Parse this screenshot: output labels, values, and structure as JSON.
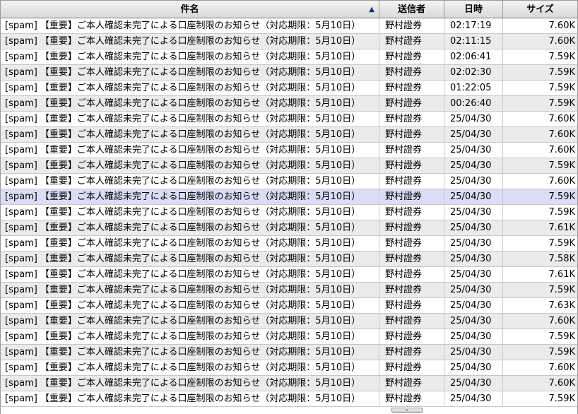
{
  "columns": {
    "subject": "件名",
    "sender": "送信者",
    "date": "日時",
    "size": "サイズ"
  },
  "sort": {
    "column": "subject",
    "direction": "ascending",
    "icon": "sort-up-triangle-icon"
  },
  "selected_row_index": 11,
  "rows": [
    {
      "subject": "[spam] 【重要】ご本人確認未完了による口座制限のお知らせ（対応期限：5月10日）",
      "sender": "野村證券",
      "date": "02:17:19",
      "size": "7.60K"
    },
    {
      "subject": "[spam] 【重要】ご本人確認未完了による口座制限のお知らせ（対応期限：5月10日）",
      "sender": "野村證券",
      "date": "02:11:15",
      "size": "7.60K"
    },
    {
      "subject": "[spam] 【重要】ご本人確認未完了による口座制限のお知らせ（対応期限：5月10日）",
      "sender": "野村證券",
      "date": "02:06:41",
      "size": "7.59K"
    },
    {
      "subject": "[spam] 【重要】ご本人確認未完了による口座制限のお知らせ（対応期限：5月10日）",
      "sender": "野村證券",
      "date": "02:02:30",
      "size": "7.59K"
    },
    {
      "subject": "[spam] 【重要】ご本人確認未完了による口座制限のお知らせ（対応期限：5月10日）",
      "sender": "野村證券",
      "date": "01:22:05",
      "size": "7.59K"
    },
    {
      "subject": "[spam] 【重要】ご本人確認未完了による口座制限のお知らせ（対応期限：5月10日）",
      "sender": "野村證券",
      "date": "00:26:40",
      "size": "7.59K"
    },
    {
      "subject": "[spam] 【重要】ご本人確認未完了による口座制限のお知らせ（対応期限：5月10日）",
      "sender": "野村證券",
      "date": "25/04/30",
      "size": "7.60K"
    },
    {
      "subject": "[spam] 【重要】ご本人確認未完了による口座制限のお知らせ（対応期限：5月10日）",
      "sender": "野村證券",
      "date": "25/04/30",
      "size": "7.60K"
    },
    {
      "subject": "[spam] 【重要】ご本人確認未完了による口座制限のお知らせ（対応期限：5月10日）",
      "sender": "野村證券",
      "date": "25/04/30",
      "size": "7.60K"
    },
    {
      "subject": "[spam] 【重要】ご本人確認未完了による口座制限のお知らせ（対応期限：5月10日）",
      "sender": "野村證券",
      "date": "25/04/30",
      "size": "7.59K"
    },
    {
      "subject": "[spam] 【重要】ご本人確認未完了による口座制限のお知らせ（対応期限：5月10日）",
      "sender": "野村證券",
      "date": "25/04/30",
      "size": "7.60K"
    },
    {
      "subject": "[spam] 【重要】ご本人確認未完了による口座制限のお知らせ（対応期限：5月10日）",
      "sender": "野村證券",
      "date": "25/04/30",
      "size": "7.59K"
    },
    {
      "subject": "[spam] 【重要】ご本人確認未完了による口座制限のお知らせ（対応期限：5月10日）",
      "sender": "野村證券",
      "date": "25/04/30",
      "size": "7.59K"
    },
    {
      "subject": "[spam] 【重要】ご本人確認未完了による口座制限のお知らせ（対応期限：5月10日）",
      "sender": "野村證券",
      "date": "25/04/30",
      "size": "7.61K"
    },
    {
      "subject": "[spam] 【重要】ご本人確認未完了による口座制限のお知らせ（対応期限：5月10日）",
      "sender": "野村證券",
      "date": "25/04/30",
      "size": "7.59K"
    },
    {
      "subject": "[spam] 【重要】ご本人確認未完了による口座制限のお知らせ（対応期限：5月10日）",
      "sender": "野村證券",
      "date": "25/04/30",
      "size": "7.58K"
    },
    {
      "subject": "[spam] 【重要】ご本人確認未完了による口座制限のお知らせ（対応期限：5月10日）",
      "sender": "野村證券",
      "date": "25/04/30",
      "size": "7.61K"
    },
    {
      "subject": "[spam] 【重要】ご本人確認未完了による口座制限のお知らせ（対応期限：5月10日）",
      "sender": "野村證券",
      "date": "25/04/30",
      "size": "7.59K"
    },
    {
      "subject": "[spam] 【重要】ご本人確認未完了による口座制限のお知らせ（対応期限：5月10日）",
      "sender": "野村證券",
      "date": "25/04/30",
      "size": "7.63K"
    },
    {
      "subject": "[spam] 【重要】ご本人確認未完了による口座制限のお知らせ（対応期限：5月10日）",
      "sender": "野村證券",
      "date": "25/04/30",
      "size": "7.60K"
    },
    {
      "subject": "[spam] 【重要】ご本人確認未完了による口座制限のお知らせ（対応期限：5月10日）",
      "sender": "野村證券",
      "date": "25/04/30",
      "size": "7.59K"
    },
    {
      "subject": "[spam] 【重要】ご本人確認未完了による口座制限のお知らせ（対応期限：5月10日）",
      "sender": "野村證券",
      "date": "25/04/30",
      "size": "7.59K"
    },
    {
      "subject": "[spam] 【重要】ご本人確認未完了による口座制限のお知らせ（対応期限：5月10日）",
      "sender": "野村證券",
      "date": "25/04/30",
      "size": "7.60K"
    },
    {
      "subject": "[spam] 【重要】ご本人確認未完了による口座制限のお知らせ（対応期限：5月10日）",
      "sender": "野村證券",
      "date": "25/04/30",
      "size": "7.60K"
    },
    {
      "subject": "[spam] 【重要】ご本人確認未完了による口座制限のお知らせ（対応期限：5月10日）",
      "sender": "野村證券",
      "date": "25/04/30",
      "size": "7.59K"
    }
  ],
  "colors": {
    "row_alt": "#ebebeb",
    "row_selected": "#dcdcf6",
    "sort_arrow": "#1d2b7a"
  },
  "splitter": {
    "icon": "chevron-down-icon"
  }
}
